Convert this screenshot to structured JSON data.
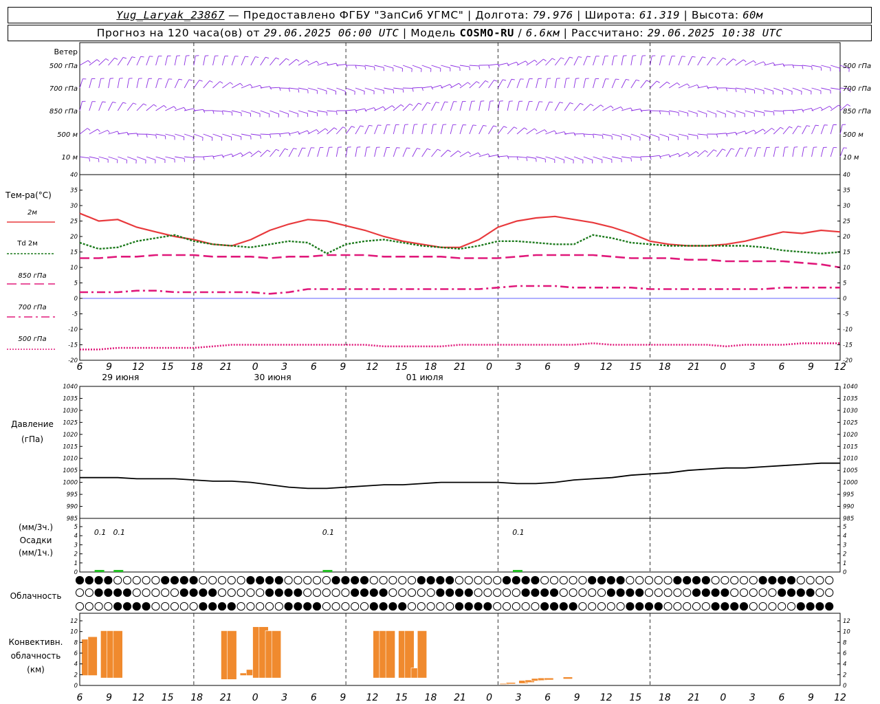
{
  "header": {
    "station": "Yug_Laryak_23867",
    "provider": "— Предоставлено ФГБУ \"ЗапСиб УГМС\"",
    "lon_label": "Долгота:",
    "lon": "79.976",
    "lat_label": "Широта:",
    "lat": "61.319",
    "alt_label": "Высота:",
    "alt": "60м",
    "forecast_prefix": "Прогноз на 120 часа(ов) от",
    "forecast_time": "29.06.2025 06:00 UTC",
    "model_label": "Модель",
    "model": "COSMO-RU",
    "model_res": "6.6км",
    "calc_label": "Рассчитано:",
    "calc_time": "29.06.2025 10:38 UTC"
  },
  "panels": {
    "wind": {
      "title": "Ветер",
      "levels": [
        "500 гПа",
        "700 гПа",
        "850 гПа",
        "500 м",
        "10 м"
      ]
    },
    "temp": {
      "title": "Тем-ра(°С)",
      "legend": [
        "2м",
        "Td 2м",
        "850 гПа",
        "700 гПа",
        "500 гПа"
      ],
      "ylim": [
        -20,
        40
      ],
      "ticks": [
        "40",
        "35",
        "30",
        "25",
        "20",
        "15",
        "10",
        "5",
        "0",
        "-5",
        "-10",
        "-15",
        "-20"
      ]
    },
    "pressure": {
      "title_line1": "Давление",
      "title_line2": "(гПа)",
      "ylim": [
        985,
        1040
      ],
      "ticks": [
        "1040",
        "1035",
        "1030",
        "1025",
        "1020",
        "1015",
        "1010",
        "1005",
        "1000",
        "995",
        "990",
        "985"
      ]
    },
    "precip": {
      "label1": "(мм/3ч.)",
      "label2": "Осадки",
      "label3": "(мм/1ч.)",
      "ticks": [
        "5",
        "4",
        "3",
        "2",
        "1",
        "0"
      ],
      "annotations": [
        "0.1",
        "0.1",
        "0.1",
        "0.1"
      ]
    },
    "cloud": {
      "title": "Облачность"
    },
    "convective": {
      "title_line1": "Конвективн.",
      "title_line2": "облачность",
      "title_line3": "(км)",
      "ticks": [
        "12",
        "10",
        "8",
        "6",
        "4",
        "2",
        "0"
      ]
    }
  },
  "time_axis": {
    "hour_labels": [
      "6",
      "9",
      "12",
      "15",
      "18",
      "21",
      "0",
      "3",
      "6",
      "9",
      "12",
      "15",
      "18",
      "21",
      "0",
      "3",
      "6",
      "9",
      "12",
      "15",
      "18",
      "21",
      "0",
      "3",
      "6",
      "9",
      "12"
    ],
    "day_labels": [
      "29 июня",
      "30 июня",
      "01 июля"
    ]
  },
  "colors": {
    "wind": "#8a2be2",
    "t2m": "#e8393c",
    "td2m": "#1c7a1c",
    "t850": "#e0187a",
    "t700": "#e0187a",
    "t500": "#e0187a",
    "zero_line": "#2b2bff",
    "pressure": "#000000",
    "precip": "#22c022",
    "convective": "#f08a2e"
  },
  "chart_data": [
    {
      "type": "line",
      "title": "Тем-ра(°С)",
      "x_hours_from_start": [
        0,
        3,
        6,
        9,
        12,
        15,
        18,
        21,
        24,
        27,
        30,
        33,
        36,
        39,
        42,
        45,
        48,
        51,
        54,
        57,
        60,
        63,
        66,
        69,
        72,
        75,
        78,
        81,
        84,
        87,
        90,
        93,
        96,
        99,
        102,
        105,
        108,
        111,
        114,
        117,
        120
      ],
      "series": [
        {
          "name": "2м",
          "values": [
            27.5,
            25,
            25.5,
            23,
            21.5,
            20,
            19,
            17.5,
            17,
            19,
            22,
            24,
            25.5,
            25,
            23.5,
            22,
            20,
            18.5,
            17.5,
            16.5,
            16.5,
            19,
            23,
            25,
            26,
            26.5,
            25.5,
            24.5,
            23,
            21,
            18.5,
            17.5,
            17,
            17,
            17.5,
            18.5,
            20,
            21.5,
            21,
            22,
            21.5
          ]
        },
        {
          "name": "Td 2м",
          "values": [
            18,
            16,
            16.5,
            18.5,
            19.5,
            20.5,
            18.5,
            17.5,
            17,
            16.5,
            17.5,
            18.5,
            18,
            14.5,
            17.5,
            18.5,
            19,
            18,
            17,
            16.5,
            16,
            17,
            18.5,
            18.5,
            18,
            17.5,
            17.5,
            20.5,
            19.5,
            18,
            17.5,
            17,
            17,
            17,
            17,
            17,
            16.5,
            15.5,
            15,
            14.5,
            15
          ]
        },
        {
          "name": "850 гПа",
          "values": [
            13,
            13,
            13.5,
            13.5,
            14,
            14,
            14,
            13.5,
            13.5,
            13.5,
            13,
            13.5,
            13.5,
            14,
            14,
            14,
            13.5,
            13.5,
            13.5,
            13.5,
            13,
            13,
            13,
            13.5,
            14,
            14,
            14,
            14,
            13.5,
            13,
            13,
            13,
            12.5,
            12.5,
            12,
            12,
            12,
            12,
            11.5,
            11,
            10
          ]
        },
        {
          "name": "700 гПа",
          "values": [
            2,
            2,
            2,
            2.5,
            2.5,
            2,
            2,
            2,
            2,
            2,
            1.5,
            2,
            3,
            3,
            3,
            3,
            3,
            3,
            3,
            3,
            3,
            3,
            3.5,
            4,
            4,
            4,
            3.5,
            3.5,
            3.5,
            3.5,
            3,
            3,
            3,
            3,
            3,
            3,
            3,
            3.5,
            3.5,
            3.5,
            3.5
          ]
        },
        {
          "name": "500 гПа",
          "values": [
            -16.5,
            -16.5,
            -16,
            -16,
            -16,
            -16,
            -16,
            -15.5,
            -15,
            -15,
            -15,
            -15,
            -15,
            -15,
            -15,
            -15,
            -15.5,
            -15.5,
            -15.5,
            -15.5,
            -15,
            -15,
            -15,
            -15,
            -15,
            -15,
            -15,
            -14.5,
            -15,
            -15,
            -15,
            -15,
            -15,
            -15,
            -15.5,
            -15,
            -15,
            -15,
            -14.5,
            -14.5,
            -14.5
          ]
        }
      ],
      "ylim": [
        -20,
        40
      ]
    },
    {
      "type": "line",
      "title": "Давление",
      "ylabel": "(гПа)",
      "x_hours_from_start": [
        0,
        3,
        6,
        9,
        12,
        15,
        18,
        21,
        24,
        27,
        30,
        33,
        36,
        39,
        42,
        45,
        48,
        51,
        54,
        57,
        60,
        63,
        66,
        69,
        72,
        75,
        78,
        81,
        84,
        87,
        90,
        93,
        96,
        99,
        102,
        105,
        108,
        111,
        114,
        117,
        120
      ],
      "series": [
        {
          "values": [
            1002,
            1002,
            1002,
            1001.5,
            1001.5,
            1001.5,
            1001,
            1000.5,
            1000.5,
            1000,
            999,
            998,
            997.5,
            997.5,
            998,
            998.5,
            999,
            999,
            999.5,
            1000,
            1000,
            1000,
            1000,
            999.5,
            999.5,
            1000,
            1001,
            1001.5,
            1002,
            1003,
            1003.5,
            1004,
            1005,
            1005.5,
            1006,
            1006,
            1006.5,
            1007,
            1007.5,
            1008,
            1008
          ]
        }
      ],
      "ylim": [
        985,
        1040
      ]
    },
    {
      "type": "bar",
      "title": "Осадки",
      "x_hours_from_start": [
        3,
        6,
        39,
        69
      ],
      "values": [
        0.1,
        0.1,
        0.1,
        0.1
      ]
    },
    {
      "type": "bar",
      "title": "Конвективн. облачность (км)",
      "bars_km": [
        {
          "h": 1,
          "base": 2,
          "top": 9.3
        },
        {
          "h": 2,
          "base": 2,
          "top": 9.8
        },
        {
          "h": 4,
          "base": 1.5,
          "top": 11
        },
        {
          "h": 5,
          "base": 1.5,
          "top": 11
        },
        {
          "h": 6,
          "base": 1.5,
          "top": 11
        },
        {
          "h": 23,
          "base": 1.2,
          "top": 11
        },
        {
          "h": 24,
          "base": 1.2,
          "top": 11
        },
        {
          "h": 26,
          "base": 2,
          "top": 2.5
        },
        {
          "h": 27,
          "base": 2,
          "top": 3.2
        },
        {
          "h": 28,
          "base": 1.5,
          "top": 11.8
        },
        {
          "h": 29,
          "base": 1.5,
          "top": 11.8
        },
        {
          "h": 30,
          "base": 1.5,
          "top": 11
        },
        {
          "h": 31,
          "base": 1.5,
          "top": 11
        },
        {
          "h": 47,
          "base": 1.5,
          "top": 11
        },
        {
          "h": 48,
          "base": 1.5,
          "top": 11
        },
        {
          "h": 49,
          "base": 1.5,
          "top": 11
        },
        {
          "h": 51,
          "base": 1.5,
          "top": 11
        },
        {
          "h": 52,
          "base": 1.5,
          "top": 11
        },
        {
          "h": 53,
          "base": 1.5,
          "top": 3.5
        },
        {
          "h": 54,
          "base": 1.5,
          "top": 11
        },
        {
          "h": 67,
          "base": 0.2,
          "top": 0.4
        },
        {
          "h": 68,
          "base": 0.3,
          "top": 0.6
        },
        {
          "h": 70,
          "base": 0.4,
          "top": 1
        },
        {
          "h": 71,
          "base": 0.6,
          "top": 1.1
        },
        {
          "h": 72,
          "base": 0.9,
          "top": 1.4
        },
        {
          "h": 73,
          "base": 1,
          "top": 1.5
        },
        {
          "h": 74,
          "base": 1.1,
          "top": 1.5
        },
        {
          "h": 77,
          "base": 1.3,
          "top": 1.7
        }
      ],
      "ylim": [
        0,
        13
      ]
    }
  ]
}
